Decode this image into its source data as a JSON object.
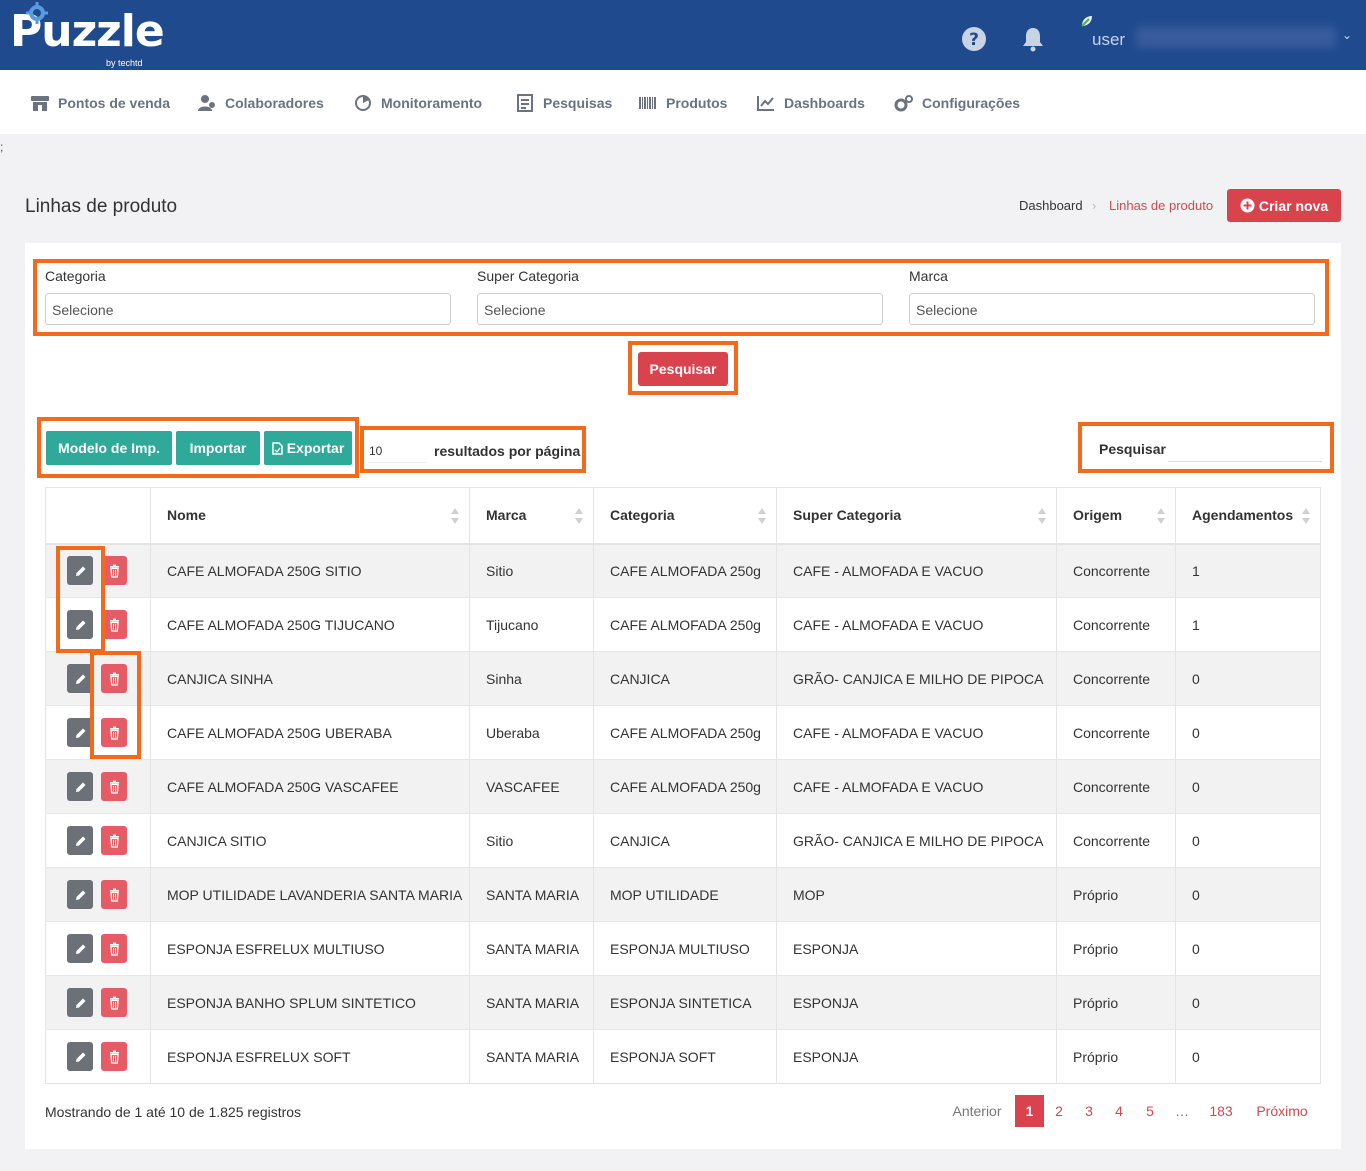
{
  "app": {
    "logo": "Puzzle",
    "logo_sub": "by techtd",
    "user_label": "user",
    "user_caret": "⌄"
  },
  "nav": [
    {
      "label": "Pontos de venda",
      "icon": "store-icon"
    },
    {
      "label": "Colaboradores",
      "icon": "users-icon"
    },
    {
      "label": "Monitoramento",
      "icon": "radar-icon"
    },
    {
      "label": "Pesquisas",
      "icon": "survey-icon"
    },
    {
      "label": "Produtos",
      "icon": "barcode-icon"
    },
    {
      "label": "Dashboards",
      "icon": "chart-icon"
    },
    {
      "label": "Configurações",
      "icon": "cogs-icon"
    }
  ],
  "stray_char": ";",
  "page": {
    "title": "Linhas de produto",
    "breadcrumb": {
      "home": "Dashboard",
      "current": "Linhas de produto"
    },
    "create_button": "Criar nova"
  },
  "filters": {
    "categoria": {
      "label": "Categoria",
      "value": "Selecione"
    },
    "super_categoria": {
      "label": "Super Categoria",
      "value": "Selecione"
    },
    "marca": {
      "label": "Marca",
      "value": "Selecione"
    },
    "search_button": "Pesquisar"
  },
  "toolbar": {
    "model_button": "Modelo de Imp.",
    "import_button": "Importar",
    "export_button": "Exportar",
    "per_page_value": "10",
    "per_page_label": "resultados por página",
    "search_label": "Pesquisar"
  },
  "table": {
    "columns": [
      "Nome",
      "Marca",
      "Categoria",
      "Super Categoria",
      "Origem",
      "Agendamentos"
    ],
    "rows": [
      {
        "nome": "CAFE ALMOFADA 250G SITIO",
        "marca": "Sitio",
        "categoria": "CAFE ALMOFADA 250g",
        "super": "CAFE - ALMOFADA E VACUO",
        "origem": "Concorrente",
        "agend": "1"
      },
      {
        "nome": "CAFE ALMOFADA 250G TIJUCANO",
        "marca": "Tijucano",
        "categoria": "CAFE ALMOFADA 250g",
        "super": "CAFE - ALMOFADA E VACUO",
        "origem": "Concorrente",
        "agend": "1"
      },
      {
        "nome": "CANJICA SINHA",
        "marca": "Sinha",
        "categoria": "CANJICA",
        "super": "GRÃO- CANJICA E MILHO DE PIPOCA",
        "origem": "Concorrente",
        "agend": "0"
      },
      {
        "nome": "CAFE ALMOFADA 250G UBERABA",
        "marca": "Uberaba",
        "categoria": "CAFE ALMOFADA 250g",
        "super": "CAFE - ALMOFADA E VACUO",
        "origem": "Concorrente",
        "agend": "0"
      },
      {
        "nome": "CAFE ALMOFADA 250G VASCAFEE",
        "marca": "VASCAFEE",
        "categoria": "CAFE ALMOFADA 250g",
        "super": "CAFE - ALMOFADA E VACUO",
        "origem": "Concorrente",
        "agend": "0"
      },
      {
        "nome": "CANJICA SITIO",
        "marca": "Sitio",
        "categoria": "CANJICA",
        "super": "GRÃO- CANJICA E MILHO DE PIPOCA",
        "origem": "Concorrente",
        "agend": "0"
      },
      {
        "nome": "MOP UTILIDADE LAVANDERIA SANTA MARIA",
        "marca": "SANTA MARIA",
        "categoria": "MOP UTILIDADE",
        "super": "MOP",
        "origem": "Próprio",
        "agend": "0"
      },
      {
        "nome": "ESPONJA ESFRELUX MULTIUSO",
        "marca": "SANTA MARIA",
        "categoria": "ESPONJA MULTIUSO",
        "super": "ESPONJA",
        "origem": "Próprio",
        "agend": "0"
      },
      {
        "nome": "ESPONJA BANHO SPLUM SINTETICO",
        "marca": "SANTA MARIA",
        "categoria": "ESPONJA SINTETICA",
        "super": "ESPONJA",
        "origem": "Próprio",
        "agend": "0"
      },
      {
        "nome": "ESPONJA ESFRELUX SOFT",
        "marca": "SANTA MARIA",
        "categoria": "ESPONJA SOFT",
        "super": "ESPONJA",
        "origem": "Próprio",
        "agend": "0"
      }
    ]
  },
  "footer": {
    "showing": "Mostrando de 1 até 10 de 1.825 registros",
    "pagination": {
      "prev": "Anterior",
      "pages": [
        "1",
        "2",
        "3",
        "4",
        "5",
        "…",
        "183"
      ],
      "current": "1",
      "next": "Próximo"
    }
  },
  "colors": {
    "header": "#1f4b8e",
    "accent_red": "#d9434e",
    "teal": "#2ea99a",
    "highlight": "#f26a1b"
  }
}
